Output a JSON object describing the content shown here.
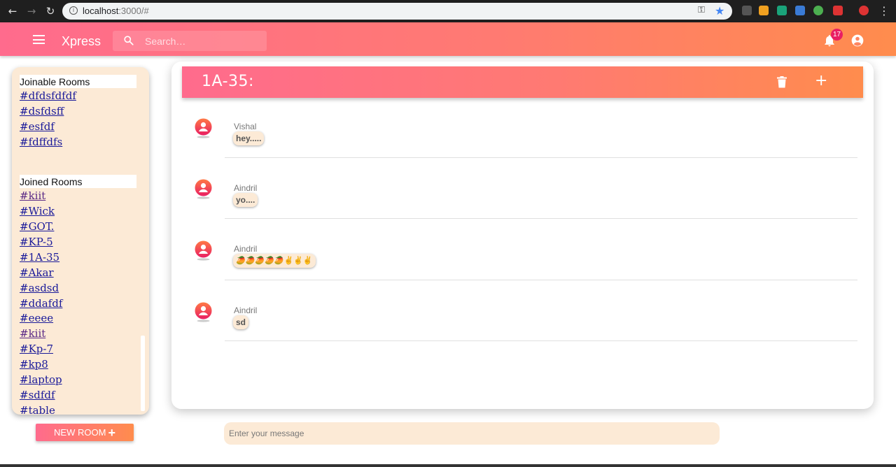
{
  "browser": {
    "url_host": "localhost",
    "url_rest": ":3000/#",
    "back_icon": "←",
    "forward_icon": "→",
    "reload_icon": "↻",
    "key_icon": "⚿",
    "star_icon": "★",
    "menu_icon": "⋮"
  },
  "appbar": {
    "brand": "Xpress",
    "search_placeholder": "Search…",
    "notification_count": "17",
    "colors": {
      "gradient_start": "#ff6b8d",
      "gradient_end": "#ff8c4d"
    }
  },
  "sidebar": {
    "joinable_title": "Joinable Rooms",
    "joinable_rooms": [
      "#dfdsfdfdf",
      "#dsfdsff",
      "#esfdf",
      "#fdffdfs"
    ],
    "joined_title": "Joined Rooms",
    "joined_rooms": [
      "#kiit",
      "#Wick",
      "#GOT.",
      "#KP-5",
      "#1A-35",
      "#Akar",
      "#asdsd",
      "#ddafdf",
      "#eeee",
      "#kiit",
      "#Kp-7",
      "#kp8",
      "#laptop",
      "#sdfdf",
      "#table"
    ],
    "new_room_label": "NEW ROOM",
    "new_room_icon": "+"
  },
  "chat": {
    "room_title": "1A-35:",
    "add_icon": "+",
    "messages": [
      {
        "sender": "Vishal",
        "text": "hey....."
      },
      {
        "sender": "Aindril",
        "text": "yo...."
      },
      {
        "sender": "Aindril",
        "text": "🥭🥭🥭🥭🥭✌️✌️✌️"
      },
      {
        "sender": "Aindril",
        "text": "sd"
      }
    ],
    "compose_placeholder": "Enter your message"
  }
}
